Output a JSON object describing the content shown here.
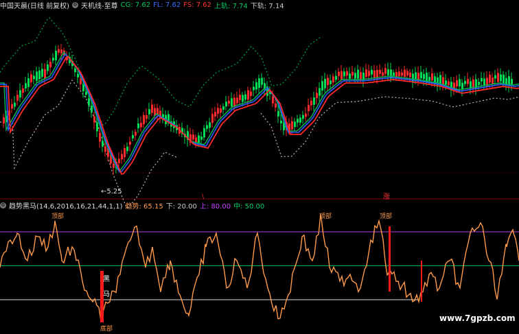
{
  "main_panel": {
    "title": "中国天晨(日线 前复权)",
    "indicator_name": "天机线-至尊",
    "values": [
      {
        "label": "CG: 7.62",
        "color": "#00cc66"
      },
      {
        "label": "FL: 7.62",
        "color": "#3b6cff"
      },
      {
        "label": "FS: 7.62",
        "color": "#ff3030"
      },
      {
        "label": "上轨: 7.74",
        "color": "#00cc66"
      },
      {
        "label": "下轨: 7.14",
        "color": "#cccccc"
      }
    ],
    "low_marker": "←5.25",
    "signal_small": "\\",
    "signal_tag": "涨"
  },
  "indicator_panel": {
    "title": "趋势黑马(14,6,2016,16,21,44,1,1)",
    "values": [
      {
        "label": "趋势: 65.15",
        "color": "#ff9a4a"
      },
      {
        "label": "下: 20.00",
        "color": "#cccccc"
      },
      {
        "label": "上: 80.00",
        "color": "#c040ff"
      },
      {
        "label": "中: 50.00",
        "color": "#00cc66"
      }
    ],
    "top_labels": [
      "顶部",
      "顶部",
      "顶部"
    ],
    "bottom_label": "底部",
    "dark_horse_chars": [
      "黑",
      "马"
    ],
    "upper_level": 80,
    "mid_level": 50,
    "lower_level": 20
  },
  "watermark": "www.7gpzb.com",
  "colors": {
    "background": "#000000",
    "up_candle": "#ff2a2a",
    "down_candle": "#00dd55",
    "fs_line": "#ff2a2a",
    "fl_line": "#2f5bff",
    "cg_line": "#00aa55",
    "upper_band": "#00aa44",
    "lower_band": "#bbbbbb",
    "trend_line": "#ff9a4a",
    "upper_level_line": "#b040e0",
    "mid_level_line": "#00bb55",
    "lower_level_line": "#dddddd",
    "grid_red": "#7a0000"
  }
}
